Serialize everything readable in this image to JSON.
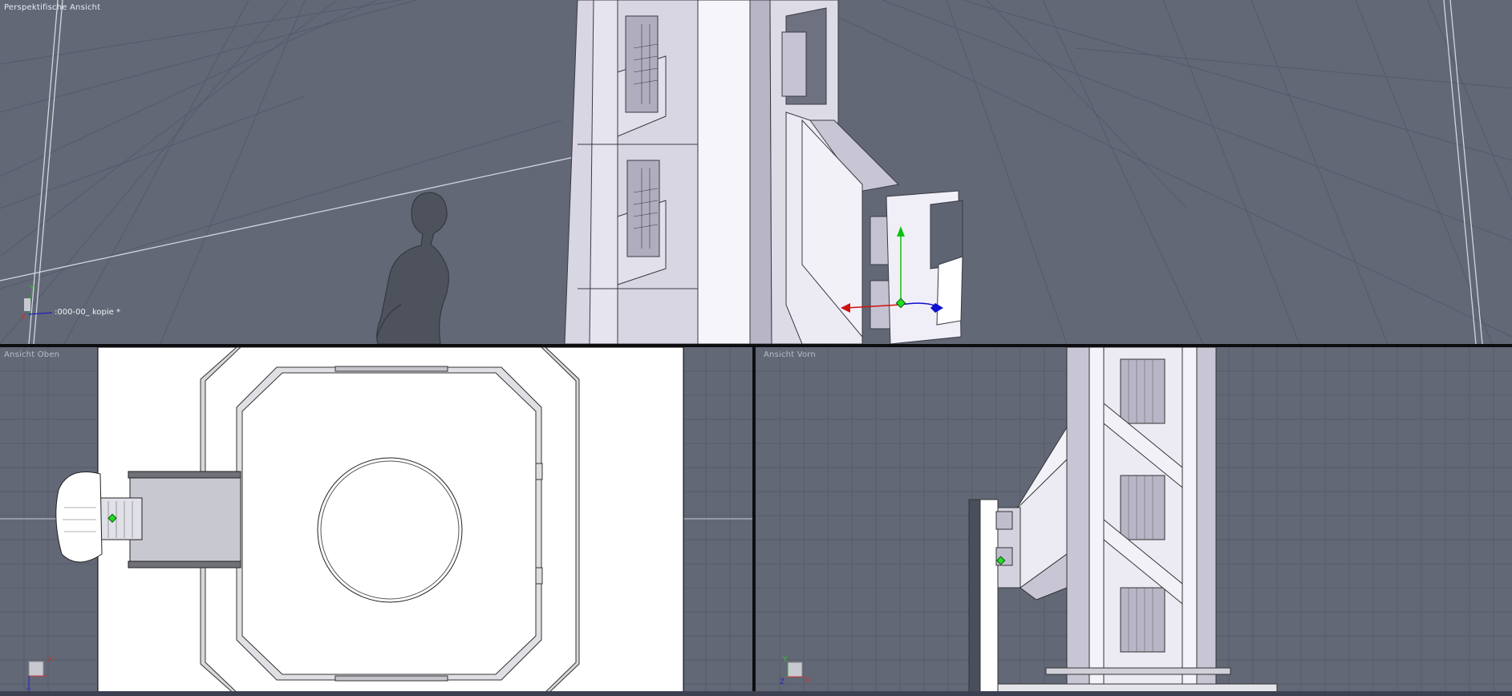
{
  "viewports": {
    "perspective": {
      "label": "Perspektifische Ansicht",
      "selected_object": ":000-00_ kopie *"
    },
    "top": {
      "label": "Ansicht Oben"
    },
    "front": {
      "label": "Ansicht Vorn"
    }
  },
  "axes": {
    "x": "X",
    "y": "Y",
    "z": "Z"
  },
  "colors": {
    "viewport_bg": "#626876",
    "grid": "#4f5464",
    "model": "#eceaf2",
    "gizmo_x": "#d01010",
    "gizmo_y": "#10c010",
    "gizmo_z": "#1010d0"
  }
}
